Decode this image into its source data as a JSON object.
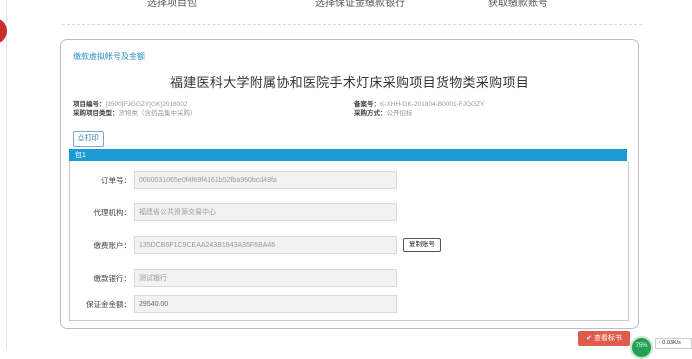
{
  "top_steps": [
    "选择项目包",
    "选择保证金缴款银行",
    "获取缴款账号"
  ],
  "section_title": "缴款虚拟帐号及金额",
  "project": {
    "title": "福建医科大学附属协和医院手术灯床采购项目货物类采购项目",
    "code_label": "项目编号：",
    "code_value": "[3500]FJGGZY[GK]2018002",
    "type_label": "采购项目类型：",
    "type_value": "货物类（含药品集中采购）",
    "record_label": "备案号：",
    "record_value": "K-XHH-GK-201804-B0001-FJGGZY",
    "method_label": "采购方式：",
    "method_value": "公开招标"
  },
  "print_label": "打印",
  "package_label": "包1",
  "fields": [
    {
      "label": "订单号：",
      "value": "0000031065e0f4f69f4161b52fba960bcd49fa"
    },
    {
      "label": "代理机构：",
      "value": "福建省公共资源交易中心"
    },
    {
      "label": "缴费账户：",
      "value": "135DCB6F1C9CEAA243B1843A35F6BA46"
    },
    {
      "label": "缴款银行：",
      "value": "测试银行"
    },
    {
      "label": "保证金金额：",
      "value": "29540.00"
    }
  ],
  "copy_account_label": "复制账号",
  "view_bid_label": "查看标书",
  "speed_percent": "75%",
  "speed_rate": "0.03K/s"
}
